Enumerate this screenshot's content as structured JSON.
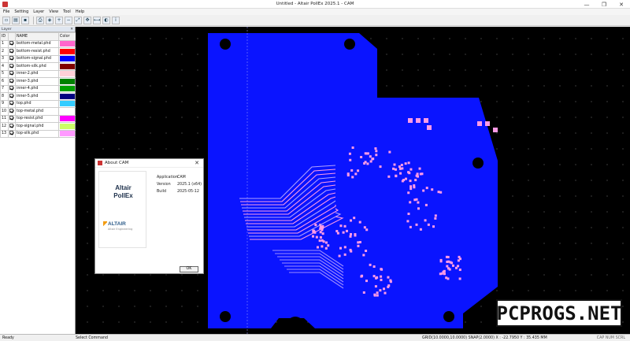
{
  "window": {
    "title": "Untitled - Altair PollEx 2025.1 - CAM",
    "controls": [
      "—",
      "❐",
      "✕"
    ]
  },
  "menu": [
    "File",
    "Setting",
    "Layer",
    "View",
    "Tool",
    "Help"
  ],
  "toolbar": {
    "icons": [
      "new-icon",
      "open-icon",
      "save-icon",
      "print-icon",
      "layer-icon",
      "zoom-in-icon",
      "zoom-out-icon",
      "zoom-fit-icon",
      "pan-icon",
      "measure-icon",
      "color-icon",
      "info-icon"
    ]
  },
  "layer_panel": {
    "header": "Layer",
    "columns": [
      "ID",
      "",
      "NAME",
      "Color"
    ],
    "rows": [
      {
        "id": "1",
        "name": "bottom-metal.phd",
        "color": "#ff66cc"
      },
      {
        "id": "2",
        "name": "bottom-resist.phd",
        "color": "#ff0000"
      },
      {
        "id": "3",
        "name": "bottom-signal.phd",
        "color": "#0000ff"
      },
      {
        "id": "4",
        "name": "bottom-silk.phd",
        "color": "#800000"
      },
      {
        "id": "5",
        "name": "inner-2.phd",
        "color": "#ffd0d8"
      },
      {
        "id": "6",
        "name": "inner-3.phd",
        "color": "#008000"
      },
      {
        "id": "7",
        "name": "inner-4.phd",
        "color": "#00a000"
      },
      {
        "id": "8",
        "name": "inner-5.phd",
        "color": "#000080"
      },
      {
        "id": "9",
        "name": "top.phd",
        "color": "#33ccff"
      },
      {
        "id": "10",
        "name": "top-metal.phd",
        "color": "#ffffff"
      },
      {
        "id": "11",
        "name": "top-resist.phd",
        "color": "#ff00ff"
      },
      {
        "id": "12",
        "name": "top-signal.phd",
        "color": "#ccff66"
      },
      {
        "id": "13",
        "name": "top-silk.phd",
        "color": "#ff99ff"
      }
    ]
  },
  "board": {
    "copper_color": "#0a14ff",
    "pad_color": "#ff9be6",
    "background": "#000000"
  },
  "about_dialog": {
    "title": "About CAM",
    "product_line1": "Altair",
    "product_line2": "PollEx",
    "brand": "ALTAIR",
    "tagline": "Altair Engineering",
    "fields": [
      {
        "key": "Application",
        "value": "CAM"
      },
      {
        "key": "Version",
        "value": "2025.1 (x64)"
      },
      {
        "key": "Build",
        "value": "2025-05-12"
      }
    ],
    "ok_label": "OK"
  },
  "status": {
    "left": "Ready",
    "command": "Select Command",
    "coords": "GRID(10.0000,10.0000) SNAP(2.0000) X : -22.7950 Y : 35.435 MM",
    "right": "CAP NUM SCRL"
  },
  "watermark": "PCPROGS.NET"
}
